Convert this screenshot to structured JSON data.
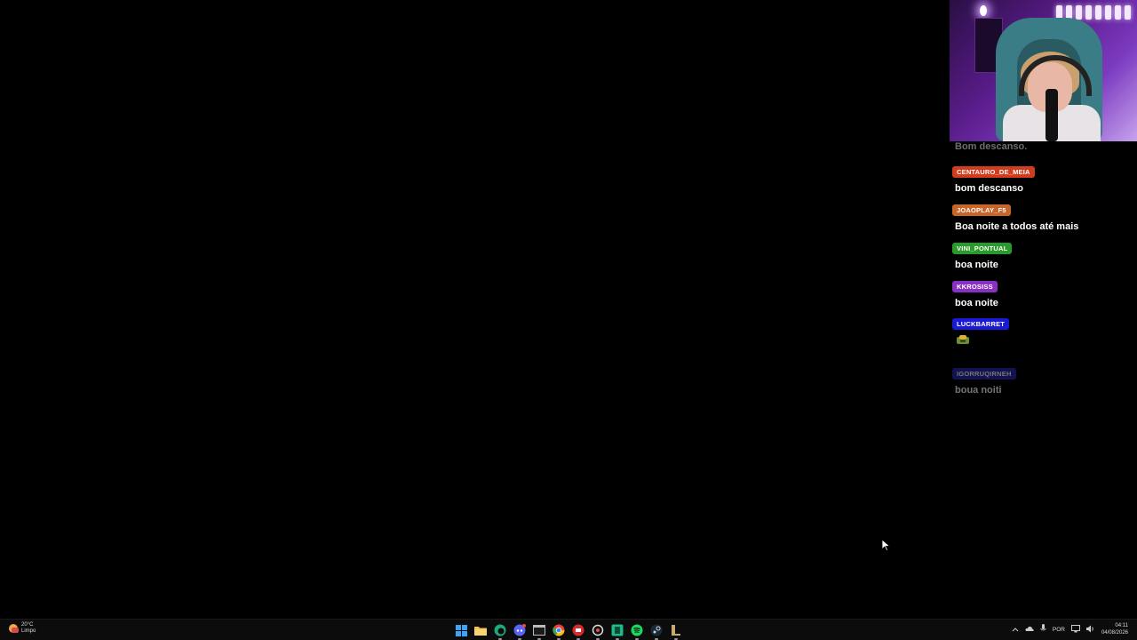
{
  "chat": {
    "faded_message": "Bom descanso.",
    "messages": [
      {
        "user": "CENTAURO_DE_MEIA",
        "color": "#d13b1e",
        "text": "bom descanso"
      },
      {
        "user": "JOAOPLAY_F5",
        "color": "#c8662a",
        "text": "Boa noite a todos até mais"
      },
      {
        "user": "VINI_PONTUAL",
        "color": "#2a9a2a",
        "text": "boa noite"
      },
      {
        "user": "KKROSISS",
        "color": "#8a2fc4",
        "text": "boa noite"
      },
      {
        "user": "LUCKBARRET",
        "color": "#1a1ad6",
        "emote": "emote-icon"
      },
      {
        "user": "IGORRUQIRNEH",
        "color": "#2a2ab8",
        "text": "boua noiti"
      }
    ]
  },
  "taskbar": {
    "weather": {
      "temp": "20°C",
      "condition": "Limpo"
    },
    "apps": [
      "start-icon",
      "file-explorer-icon",
      "edge-icon",
      "discord-icon",
      "terminal-icon",
      "chrome-icon",
      "app-red-icon",
      "app-settings-icon",
      "app-green-icon",
      "spotify-icon",
      "steam-icon",
      "league-icon"
    ],
    "language": "POR",
    "time": "04:11",
    "date": "04/08/2026"
  }
}
